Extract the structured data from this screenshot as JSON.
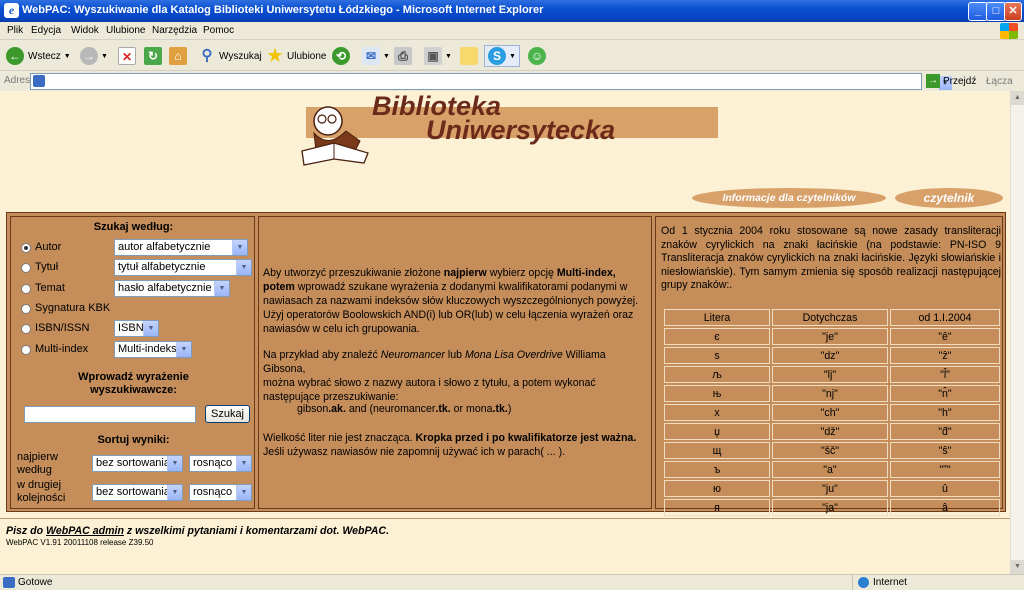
{
  "window": {
    "title": "WebPAC: Wyszukiwanie dla Katalog Biblioteki Uniwersytetu Łódzkiego - Microsoft Internet Explorer"
  },
  "menu": [
    "Plik",
    "Edycja",
    "Widok",
    "Ulubione",
    "Narzędzia",
    "Pomoc"
  ],
  "toolbar": {
    "back": "Wstecz",
    "search": "Wyszukaj",
    "favorites": "Ulubione"
  },
  "address": {
    "label": "Adres",
    "value": "",
    "go": "Przejdź",
    "links": "Łącza"
  },
  "logo": {
    "line1": "Biblioteka",
    "line2": "Uniwersytecka"
  },
  "nav": {
    "info": "Informacje dla czytelników",
    "reader": "czytelnik"
  },
  "search": {
    "heading": "Szukaj według:",
    "fields": [
      {
        "label": "Autor",
        "select": "autor alfabetycznie",
        "selected": true
      },
      {
        "label": "Tytuł",
        "select": "tytuł alfabetycznie",
        "selected": false
      },
      {
        "label": "Temat",
        "select": "hasło alfabetycznie",
        "selected": false
      },
      {
        "label": "Sygnatura KBK",
        "select": "",
        "selected": false
      },
      {
        "label": "ISBN/ISSN",
        "select": "ISBN",
        "selected": false
      },
      {
        "label": "Multi-index",
        "select": "Multi-indeks",
        "selected": false
      }
    ],
    "enter_label1": "Wprowadź wyrażenie",
    "enter_label2": "wyszukiwawcze:",
    "query": "",
    "button": "Szukaj",
    "sort_heading": "Sortuj wyniki:",
    "sort1_label1": "najpierw",
    "sort1_label2": "według",
    "sort2_label1": "w drugiej",
    "sort2_label2": "kolejności",
    "sort_value": "bez sortowania",
    "order_value": "rosnąco"
  },
  "help": {
    "p1_a": "Aby utworzyć przeszukiwanie złożone ",
    "p1_b": "najpierw",
    "p1_c": " wybierz opcję ",
    "p1_d": "Multi-index,",
    "p1_e": "potem",
    "p1_f": " wprowadź szukane wyrażenia z dodanymi kwalifikatorami podanymi w",
    "p1_g": "nawiasach za nazwami indeksów słów kluczowych wyszczególnionych powyżej.",
    "p1_h": "Użyj operatorów Boolowskich AND(i) lub OR(lub) w celu łączenia wyrażeń oraz",
    "p1_i": "nawiasów w celu ich grupowania.",
    "p2_a": "Na przykład aby znaleźć ",
    "p2_b": "Neuromancer",
    "p2_c": " lub ",
    "p2_d": "Mona Lisa Overdrive",
    "p2_e": " Williama Gibsona,",
    "p2_f": "można wybrać słowo z nazwy autora i słowo z tytułu, a potem wykonać",
    "p2_g": "następujące przeszukiwanie:",
    "ex_a": "gibson",
    "ex_b": ".ak.",
    "ex_c": " and (neuromancer",
    "ex_d": ".tk.",
    "ex_e": " or mona",
    "ex_f": ".tk.",
    "ex_g": ")",
    "p3_a": "Wielkość liter nie jest znacząca. ",
    "p3_b": "Kropka przed i po kwalifikatorze jest ważna.",
    "p3_c": "Jeśli używasz nawiasów nie zapomnij używać ich w parach( ... )."
  },
  "translit": {
    "intro": "Od 1 stycznia 2004 roku stosowane są nowe zasady transliteracji znaków cyrylickich na znaki łacińskie (na podstawie: PN-ISO 9 Transliteracja znaków cyrylickich na znaki łacińskie. Języki słowiańskie i niesłowiańskie). Tym samym zmienia się sposób realizacji następującej grupy znaków:.",
    "headers": [
      "Litera",
      "Dotychczas",
      "od 1.I.2004"
    ],
    "rows": [
      [
        "є",
        "\"je\"",
        "\"ê\""
      ],
      [
        "ѕ",
        "\"dz\"",
        "\"ẑ\""
      ],
      [
        "љ",
        "\"lj\"",
        "\"l̂\""
      ],
      [
        "њ",
        "\"nj\"",
        "\"n̂\""
      ],
      [
        "х",
        "\"ch\"",
        "\"h\""
      ],
      [
        "џ",
        "\"dž\"",
        "\"d̂\""
      ],
      [
        "щ",
        "\"šč\"",
        "\"ŝ\""
      ],
      [
        "ъ",
        "\"a\"",
        "\"ʺ\""
      ],
      [
        "ю",
        "\"ju\"",
        "û"
      ],
      [
        "я",
        "\"ja\"",
        "â"
      ]
    ]
  },
  "footer": {
    "a": "Pisz do ",
    "link": "WebPAC admin",
    "b": " z wszelkimi pytaniami i komentarzami dot. WebPAC.",
    "version": "WebPAC V1.91 20011108 release Z39.50"
  },
  "status": {
    "text": "Gotowe",
    "zone": "Internet"
  }
}
